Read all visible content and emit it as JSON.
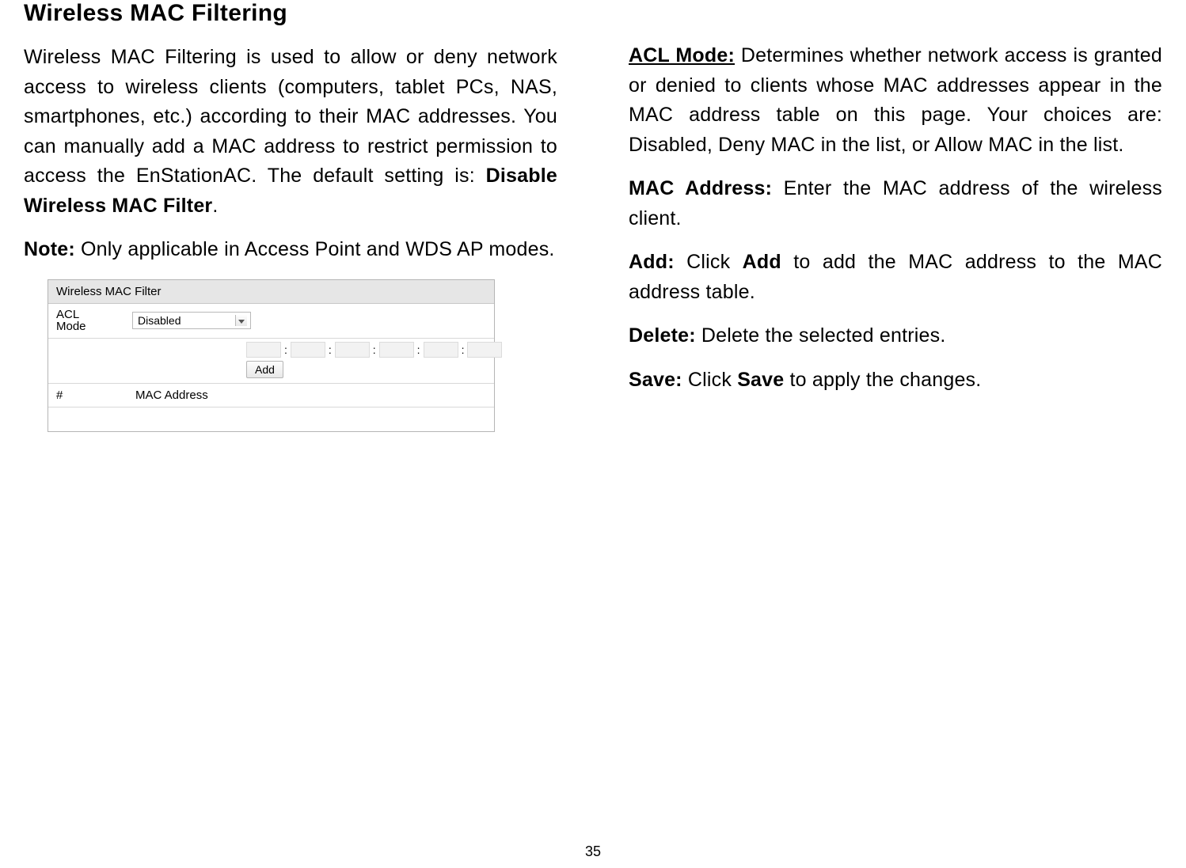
{
  "left": {
    "title": "Wireless MAC Filtering",
    "para_parts": {
      "a": "Wireless MAC Filtering is used to allow or deny network access to wireless clients (computers, tablet PCs, NAS, smartphones, etc.) according to their MAC addresses. You can manually add a MAC address to restrict permission to access the EnStationAC. The default setting is: ",
      "b": "Disable Wireless MAC Filter",
      "c": "."
    },
    "note_label": "Note:",
    "note_text": "  Only applicable in Access Point and WDS AP modes."
  },
  "figure": {
    "header": "Wireless MAC Filter",
    "acl_label_line1": "ACL",
    "acl_label_line2": "Mode",
    "acl_select_value": "Disabled",
    "add_button": "Add",
    "th_num": "#",
    "th_mac": "MAC Address"
  },
  "right": {
    "acl_mode_label": "ACL Mode:",
    "acl_mode_text": " Determines whether network access is granted or denied to clients whose MAC addresses appear in the MAC address table on this page. Your choices are: Disabled, Deny MAC in the list, or Allow MAC in the list.",
    "mac_addr_label": "MAC Address:",
    "mac_addr_text": " Enter the MAC address of the wireless client.",
    "add_label": "Add:",
    "add_text_a": " Click ",
    "add_text_bold": "Add",
    "add_text_b": " to add the MAC address to the MAC address table.",
    "delete_label": "Delete:",
    "delete_text": " Delete the selected entries.",
    "save_label": "Save:",
    "save_text_a": " Click ",
    "save_text_bold": "Save",
    "save_text_b": " to apply the changes."
  },
  "page_number": "35"
}
